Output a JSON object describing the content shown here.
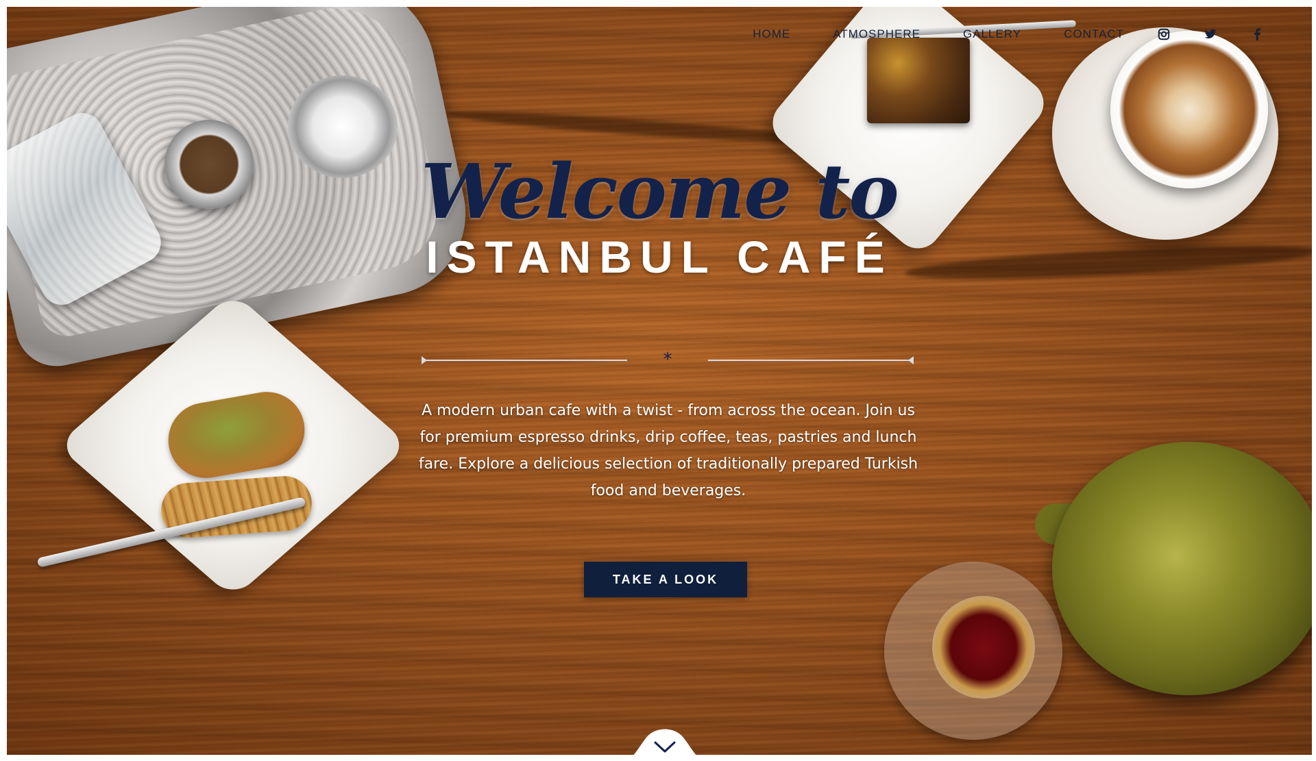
{
  "nav": {
    "links": [
      "HOME",
      "ATMOSPHERE",
      "GALLERY",
      "CONTACT"
    ],
    "social_icons": [
      "instagram-icon",
      "twitter-icon",
      "facebook-icon"
    ]
  },
  "hero": {
    "welcome": "Welcome to",
    "brand": "ISTANBUL CAFÉ",
    "divider_symbol": "*",
    "tagline": "A modern urban cafe with a twist - from across the ocean. Join us for premium espresso drinks, drip coffee, teas, pastries and lunch fare. Explore a delicious selection of traditionally prepared Turkish food and beverages.",
    "cta_label": "TAKE A LOOK"
  },
  "scroll": {
    "icon": "chevron-down-icon"
  },
  "colors": {
    "navy": "#13224a",
    "button": "#0f1f3c",
    "wood": "#9a5420",
    "white": "#ffffff"
  }
}
